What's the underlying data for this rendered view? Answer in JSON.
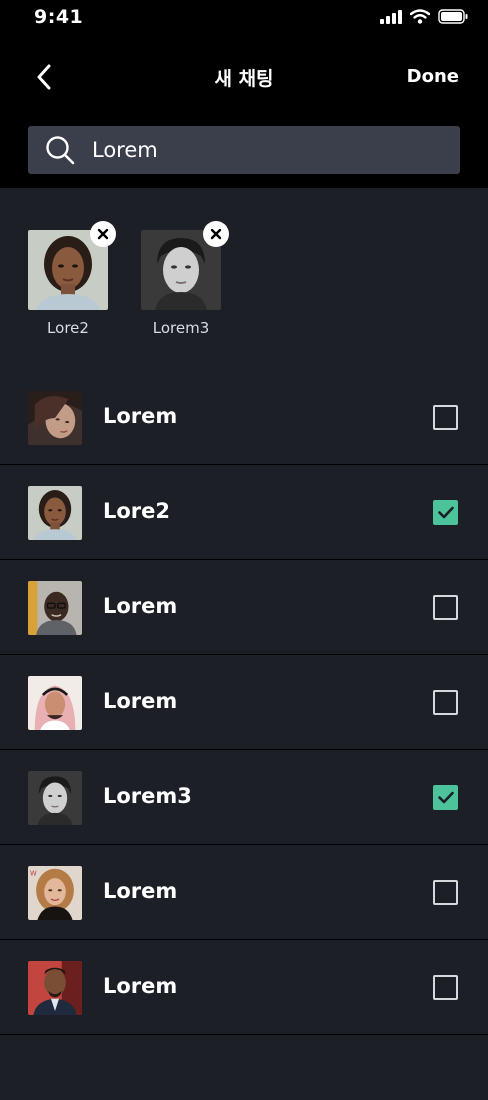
{
  "status_bar": {
    "time": "9:41"
  },
  "nav": {
    "title": "새 채팅",
    "done_label": "Done"
  },
  "search": {
    "value": "Lorem"
  },
  "selected": [
    {
      "name": "Lore2",
      "avatar": "woman-portrait-1"
    },
    {
      "name": "Lorem3",
      "avatar": "man-portrait-bw"
    }
  ],
  "contacts": [
    {
      "name": "Lorem",
      "checked": false,
      "avatar": "woman-portrait-2"
    },
    {
      "name": "Lore2",
      "checked": true,
      "avatar": "woman-portrait-1"
    },
    {
      "name": "Lorem",
      "checked": false,
      "avatar": "man-portrait-glasses"
    },
    {
      "name": "Lorem",
      "checked": false,
      "avatar": "man-portrait-headscarf"
    },
    {
      "name": "Lorem3",
      "checked": true,
      "avatar": "man-portrait-bw"
    },
    {
      "name": "Lorem",
      "checked": false,
      "avatar": "woman-portrait-blonde"
    },
    {
      "name": "Lorem",
      "checked": false,
      "avatar": "man-portrait-suit"
    }
  ],
  "colors": {
    "header_bg": "#000000",
    "body_bg": "#1c1f26",
    "search_bg": "#3b3f4c",
    "check_accent": "#4cc39a"
  }
}
